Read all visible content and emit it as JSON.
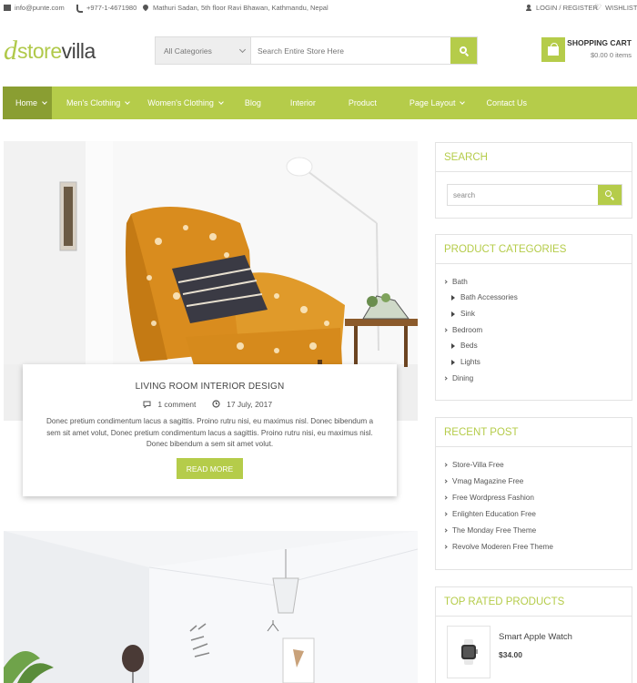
{
  "topbar": {
    "email": "info@punte.com",
    "phone": "+977-1-4671980",
    "address": "Mathuri Sadan, 5th floor Ravi Bhawan, Kathmandu, Nepal",
    "login": "LOGIN / REGISTER",
    "wishlist": "WISHLIST"
  },
  "logo": {
    "mark": "d",
    "part1": "store",
    "part2": "villa"
  },
  "search": {
    "category": "All Categories",
    "placeholder": "Search Entire Store Here"
  },
  "cart": {
    "title": "SHOPPING CART",
    "summary": "$0.00 0 items"
  },
  "nav": [
    {
      "label": "Home",
      "dropdown": true,
      "active": true
    },
    {
      "label": "Men's Clothing",
      "dropdown": true
    },
    {
      "label": "Women's Clothing",
      "dropdown": true
    },
    {
      "label": "Blog",
      "dropdown": false
    },
    {
      "label": "Interior",
      "dropdown": false
    },
    {
      "label": "Product",
      "dropdown": false
    },
    {
      "label": "Page Layout",
      "dropdown": true
    },
    {
      "label": "Contact Us",
      "dropdown": false
    }
  ],
  "post": {
    "title": "LIVING ROOM INTERIOR DESIGN",
    "comments": "1 comment",
    "date": "17 July, 2017",
    "excerpt": "Donec pretium condimentum lacus a sagittis. Proino rutru nisi, eu maximus nisl. Donec bibendum a sem sit amet volut, Donec pretium condimentum lacus a sagittis. Proino rutru nisi, eu maximus nisl. Donec bibendum a sem sit amet volut.",
    "read_more": "READ MORE"
  },
  "sidebar": {
    "search_title": "SEARCH",
    "search_placeholder": "search",
    "categories_title": "PRODUCT CATEGORIES",
    "categories": [
      {
        "label": "Bath",
        "level": 0
      },
      {
        "label": "Bath Accessories",
        "level": 1
      },
      {
        "label": "Sink",
        "level": 1
      },
      {
        "label": "Bedroom",
        "level": 0
      },
      {
        "label": "Beds",
        "level": 1
      },
      {
        "label": "Lights",
        "level": 1
      },
      {
        "label": "Dining",
        "level": 0
      }
    ],
    "recent_title": "RECENT POST",
    "recent": [
      "Store-Villa Free",
      "Vmag Magazine Free",
      "Free Wordpress Fashion",
      "Enlighten Education Free",
      "The Monday Free Theme",
      "Revolve Moderen Free Theme"
    ],
    "top_rated_title": "TOP RATED PRODUCTS",
    "product": {
      "name": "Smart Apple Watch",
      "price": "$34.00"
    }
  },
  "colors": {
    "accent": "#b5cc4a",
    "accent_dark": "#8a9e32"
  }
}
